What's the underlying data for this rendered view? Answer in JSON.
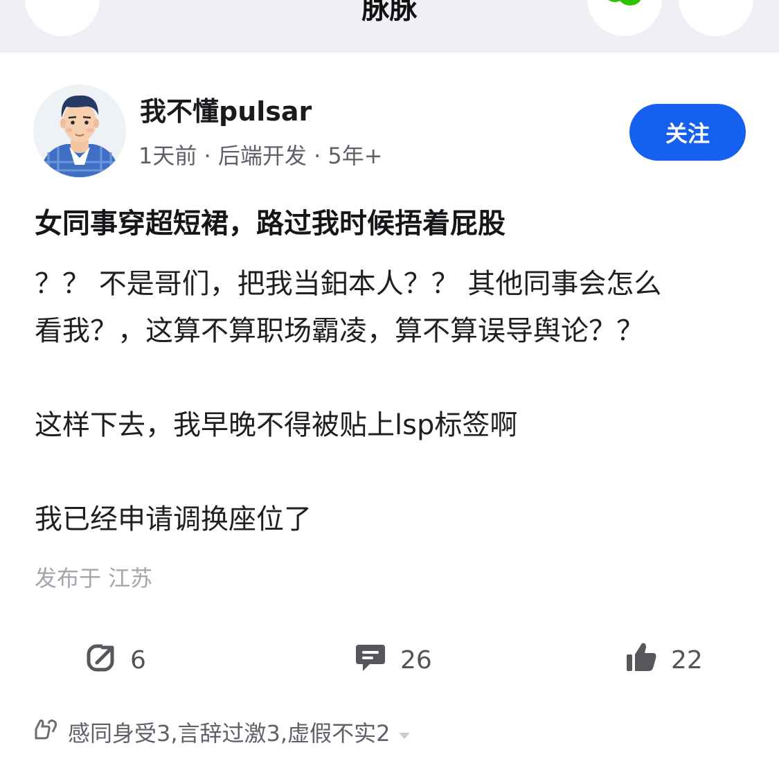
{
  "header": {
    "title": "脉脉",
    "back_icon": "chevron-left-icon",
    "share_icon": "wechat-icon",
    "more_icon": "more-icon"
  },
  "author": {
    "name": "我不懂pulsar",
    "time": "1天前",
    "role": "后端开发",
    "experience": "5年+",
    "follow_label": "关注"
  },
  "post": {
    "title": "女同事穿超短裙，路过我时候捂着屁股",
    "paragraphs": [
      "？？ 不是哥们，把我当鈤本人？？ 其他同事会怎么",
      "看我？，这算不算职场霸凌，算不算误导舆论？？",
      "这样下去，我早晚不得被贴上lsp标签啊",
      "我已经申请调换座位了"
    ],
    "location": "发布于 江苏"
  },
  "actions": {
    "repost_count": "6",
    "comment_count": "26",
    "like_count": "22"
  },
  "reactions": {
    "text": "感同身受3,言辞过激3,虚假不实2"
  },
  "colors": {
    "accent": "#1560ef",
    "topbar": "#eef0f5",
    "wechat": "#2dc100",
    "muted": "#a4a6ac"
  }
}
